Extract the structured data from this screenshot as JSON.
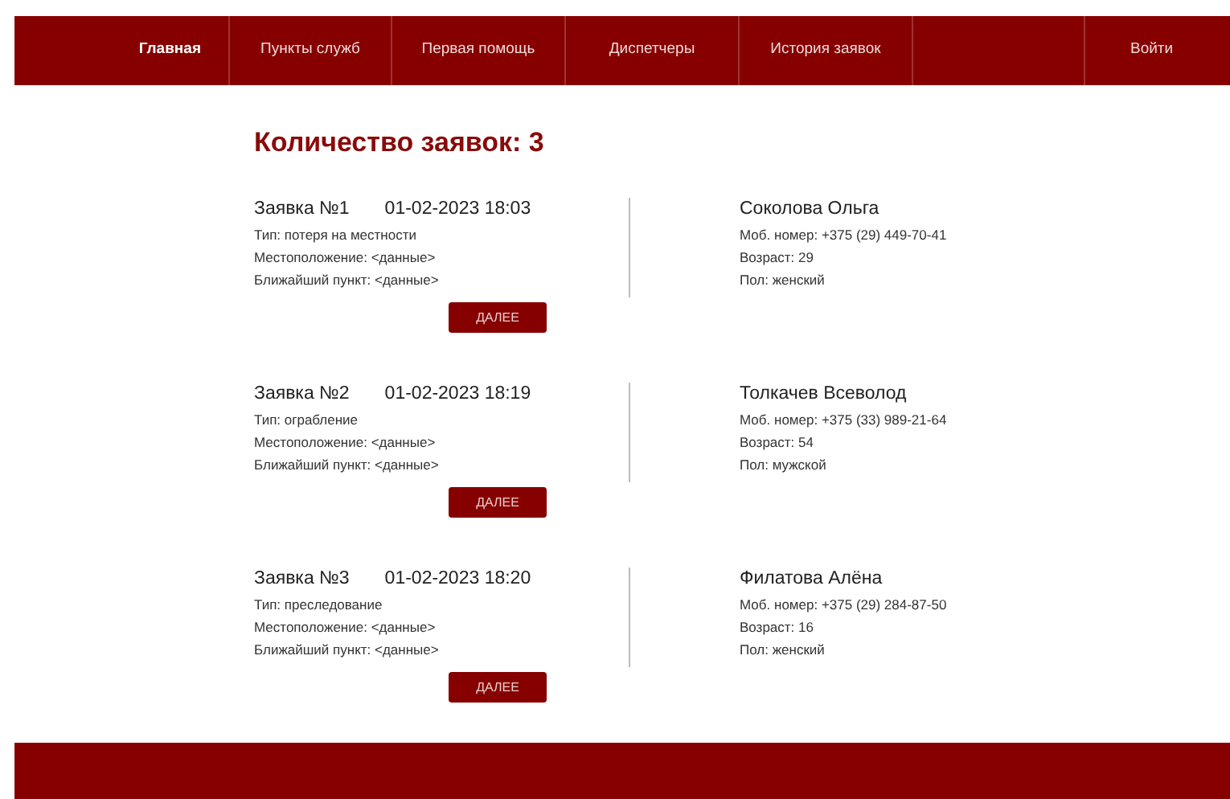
{
  "nav": {
    "items": [
      {
        "label": "Главная",
        "selected": true
      },
      {
        "label": "Пункты служб",
        "selected": false
      },
      {
        "label": "Первая помощь",
        "selected": false
      },
      {
        "label": "Диспетчеры",
        "selected": false
      },
      {
        "label": "История заявок",
        "selected": false
      }
    ],
    "login": "Войти"
  },
  "heading": "Количество заявок: 3",
  "requests": [
    {
      "title": "Заявка №1",
      "datetime": "01-02-2023 18:03",
      "type": "Тип: потеря на местности",
      "location": "Местоположение: <данные>",
      "nearest": "Ближайший пункт: <данные>",
      "button": "ДАЛЕЕ",
      "name": "Соколова Ольга",
      "phone": "Моб. номер: +375 (29) 449-70-41",
      "age": "Возраст: 29",
      "sex": "Пол: женский"
    },
    {
      "title": "Заявка №2",
      "datetime": "01-02-2023 18:19",
      "type": "Тип: ограбление",
      "location": "Местоположение: <данные>",
      "nearest": "Ближайший пункт: <данные>",
      "button": "ДАЛЕЕ",
      "name": "Толкачев Всеволод",
      "phone": "Моб. номер: +375 (33) 989-21-64",
      "age": "Возраст: 54",
      "sex": "Пол: мужской"
    },
    {
      "title": "Заявка №3",
      "datetime": "01-02-2023 18:20",
      "type": "Тип: преследование",
      "location": "Местоположение: <данные>",
      "nearest": "Ближайший пункт: <данные>",
      "button": "ДАЛЕЕ",
      "name": "Филатова Алёна",
      "phone": "Моб. номер: +375 (29) 284-87-50",
      "age": "Возраст: 16",
      "sex": "Пол: женский"
    }
  ]
}
